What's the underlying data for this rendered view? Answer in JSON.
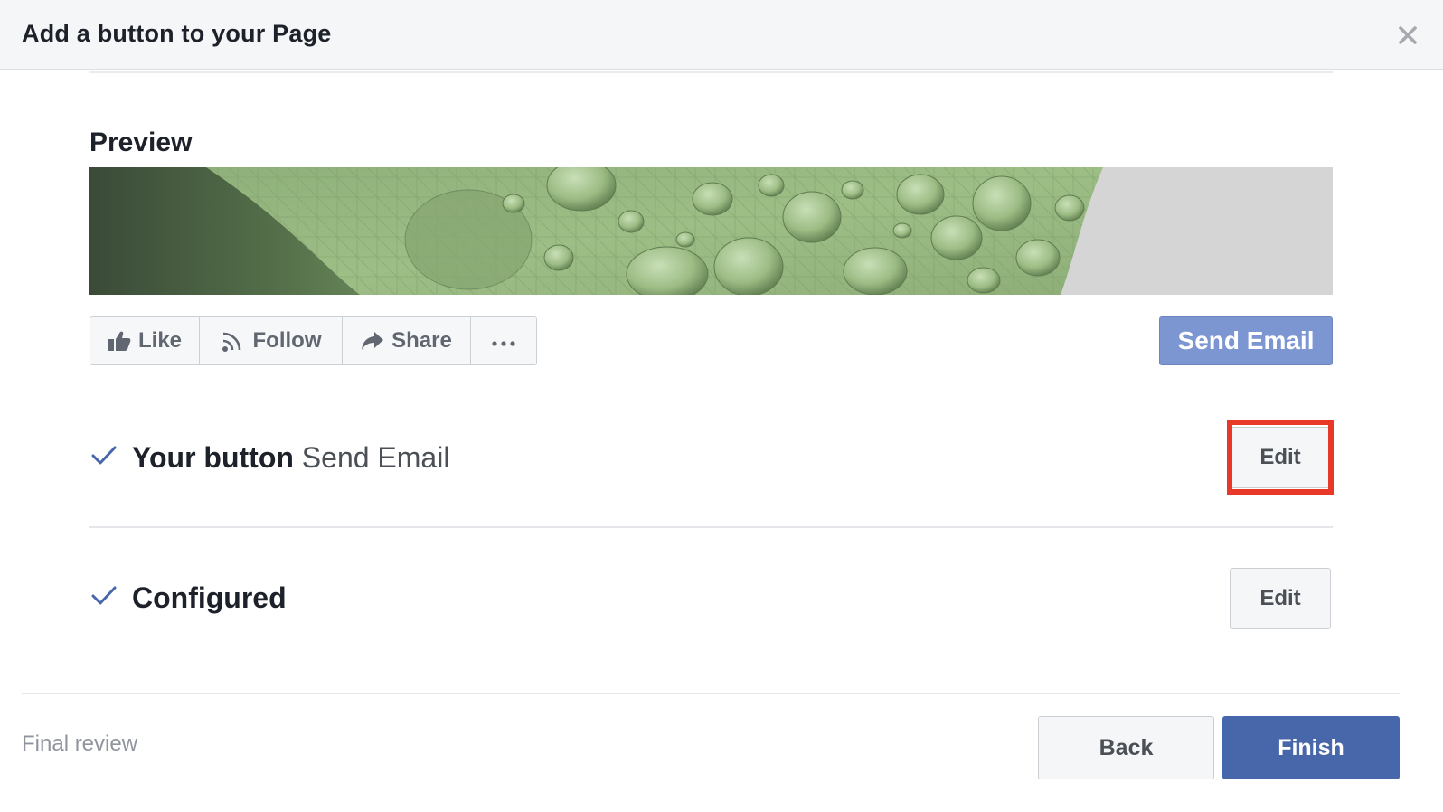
{
  "dialog": {
    "title": "Add a button to your Page",
    "close_icon": "close-icon"
  },
  "preview": {
    "label": "Preview",
    "cover_image": "leaf-with-water-drops",
    "actions": [
      {
        "label": "Like",
        "icon": "thumbs-up-icon"
      },
      {
        "label": "Follow",
        "icon": "rss-icon"
      },
      {
        "label": "Share",
        "icon": "share-arrow-icon"
      },
      {
        "label": "",
        "icon": "more-dots-icon"
      }
    ],
    "cta_label": "Send Email",
    "cta_color": "#7c96d2"
  },
  "steps": [
    {
      "title": "Your button",
      "value": "Send Email",
      "edit_label": "Edit",
      "done": true,
      "highlighted": true
    },
    {
      "title": "Configured",
      "value": "",
      "edit_label": "Edit",
      "done": true,
      "highlighted": false
    }
  ],
  "footer": {
    "step_label": "Final review",
    "back_label": "Back",
    "finish_label": "Finish",
    "finish_color": "#4867aa"
  },
  "colors": {
    "highlight": "#e8382a",
    "check": "#4867aa"
  }
}
